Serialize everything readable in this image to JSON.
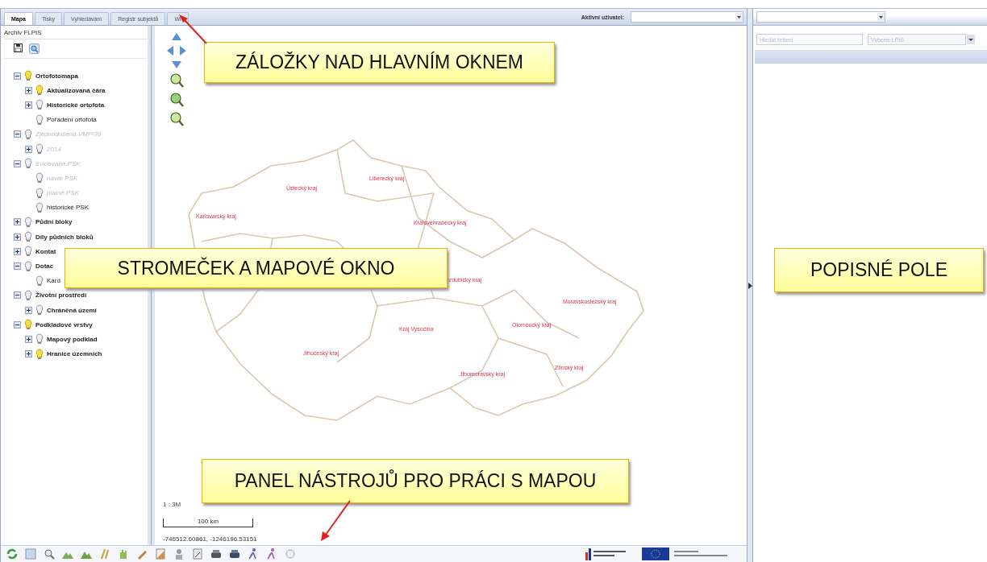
{
  "tabs": [
    {
      "label": "Mapa",
      "selected": true
    },
    {
      "label": "Tisky",
      "selected": false
    },
    {
      "label": "Vyhledávání",
      "selected": false
    },
    {
      "label": "Registr subjektů",
      "selected": false
    },
    {
      "label": "Wi",
      "selected": false
    }
  ],
  "active_user": {
    "label": "Aktivní uživatel:"
  },
  "left_panel": {
    "title": "Archiv FLPIS",
    "layers": [
      {
        "label": "Ortofotomapa",
        "on": true,
        "emphasized": true,
        "disabled": false,
        "expanded": true,
        "children": [
          {
            "label": "Aktualizovaná čára",
            "on": true,
            "emphasized": true,
            "disabled": false,
            "expanded": false
          },
          {
            "label": "Historické ortofota",
            "on": false,
            "emphasized": true,
            "disabled": false,
            "expanded": false
          },
          {
            "label": "Pořadení ortofota",
            "on": false,
            "emphasized": false,
            "disabled": false
          }
        ]
      },
      {
        "label": "Zjednodušená VMP/36",
        "on": false,
        "emphasized": false,
        "disabled": true,
        "expanded": true,
        "children": [
          {
            "label": "2014",
            "on": false,
            "emphasized": false,
            "disabled": true,
            "expanded": false
          }
        ]
      },
      {
        "label": "Evidované PSK",
        "on": false,
        "emphasized": false,
        "disabled": true,
        "expanded": true,
        "children": [
          {
            "label": "návrh PSK",
            "on": false,
            "emphasized": false,
            "disabled": true
          },
          {
            "label": "platné PSK",
            "on": false,
            "emphasized": false,
            "disabled": true
          },
          {
            "label": "historické PSK",
            "on": false,
            "emphasized": false,
            "disabled": false
          }
        ]
      },
      {
        "label": "Půdní bloky",
        "on": false,
        "emphasized": true,
        "disabled": false,
        "expanded": false
      },
      {
        "label": "Díly půdních bloků",
        "on": false,
        "emphasized": true,
        "disabled": false,
        "expanded": false
      },
      {
        "label": "Kontat",
        "on": false,
        "emphasized": true,
        "disabled": false,
        "expanded": false
      },
      {
        "label": "Dotac",
        "on": false,
        "emphasized": true,
        "disabled": false,
        "expanded": true,
        "children": [
          {
            "label": "Kard",
            "on": false,
            "emphasized": false,
            "disabled": false
          }
        ]
      },
      {
        "label": "Životní prostředí",
        "on": false,
        "emphasized": true,
        "disabled": false,
        "expanded": true,
        "children": [
          {
            "label": "Chráněná území",
            "on": false,
            "emphasized": true,
            "disabled": false,
            "expanded": false
          }
        ]
      },
      {
        "label": "Podkladové vrstvy",
        "on": true,
        "emphasized": true,
        "disabled": false,
        "expanded": true,
        "children": [
          {
            "label": "Mapový podklad",
            "on": false,
            "emphasized": true,
            "disabled": false,
            "expanded": false
          },
          {
            "label": "Hranice územních",
            "on": true,
            "emphasized": true,
            "disabled": false,
            "expanded": false
          }
        ]
      }
    ]
  },
  "map": {
    "region_labels": [
      "Ústecký kraj",
      "Liberecký kraj",
      "Karlovarský kraj",
      "Královéhradecký kraj",
      "ardubický kraj",
      "Moravskoslezský kraj",
      "Olomoucký kraj",
      "Kraj Vysočina",
      "Jihočeský kraj",
      "Zlínský kraj",
      "Jihomoravský kraj"
    ],
    "scale": "1 : 3M",
    "scale_bar": "100 km",
    "coordinates": "-746512.60861, -1246196.53151"
  },
  "side_panel": {
    "search": {
      "placeholder": "Hledat řešení"
    },
    "filter": {
      "placeholder": "Vyberte LPIS"
    }
  },
  "callouts": [
    "ZÁLOŽKY NAD HLAVNÍM OKNEM",
    "STROMEČEK A MAPOVÉ OKNO",
    "POPISNÉ POLE",
    "PANEL NÁSTROJŮ PRO PRÁCI S MAPOU"
  ]
}
